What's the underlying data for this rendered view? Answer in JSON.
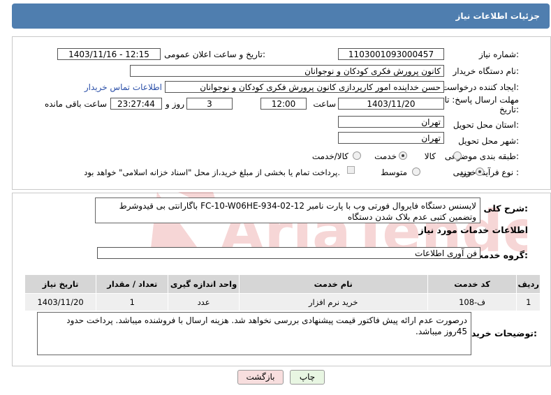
{
  "header": {
    "title": "جزئیات اطلاعات نیاز"
  },
  "form": {
    "need_number_label": "شماره نیاز:",
    "need_number": "1103001093000457",
    "announce_label": "تاریخ و ساعت اعلان عمومی:",
    "announce_value": "1403/11/16 - 12:15",
    "buyer_label": "نام دستگاه خریدار:",
    "buyer_value": "کانون پرورش فکری کودکان و نوجوانان",
    "creator_label": "ایجاد کننده درخواست:",
    "creator_value": "حسن خداینده امور کارپردازی  کانون پرورش فکری کودکان و نوجوانان",
    "contact_link": "اطلاعات تماس خریدار",
    "deadline_label_1": "مهلت ارسال پاسخ: تا",
    "deadline_label_2": "تاریخ:",
    "deadline_date": "1403/11/20",
    "time_label": "ساعت",
    "deadline_time": "12:00",
    "days_value": "3",
    "days_label": "روز و",
    "remaining_time": "23:27:44",
    "remaining_label": "ساعت باقی مانده",
    "province_label": "استان محل تحویل:",
    "province_value": "تهران",
    "city_label": "شهر محل تحویل:",
    "city_value": "تهران",
    "category_label": "طبقه بندی موضوعی:",
    "category_options": [
      "کالا",
      "خدمت",
      "کالا/خدمت"
    ],
    "category_selected": "خدمت",
    "process_label": "نوع فرآیند خرید :",
    "process_options": [
      "جزیی",
      "متوسط"
    ],
    "process_selected": "جزیی",
    "payment_note": "پرداخت تمام یا بخشی از مبلغ خرید،از محل \"اسناد خزانه اسلامی\" خواهد بود."
  },
  "description": {
    "label": "شرح کلی نیاز:",
    "text": "لایسنس دستگاه فایروال فورتی وب با پارت نامبر FC-10-W06HE-934-02-12 باگارانتی بی قیدوشرط وتضمین کتبی عدم بلاک شدن دستگاه"
  },
  "services": {
    "section_title": "اطلاعات خدمات مورد نیاز",
    "group_label": "گروه خدمت:",
    "group_value": "فن آوری اطلاعات",
    "table": {
      "headers": [
        "ردیف",
        "کد خدمت",
        "نام خدمت",
        "واحد اندازه گیری",
        "تعداد / مقدار",
        "تاریخ نیاز"
      ],
      "rows": [
        [
          "1",
          "ف-108",
          "خرید نرم افزار",
          "عدد",
          "1",
          "1403/11/20"
        ]
      ]
    }
  },
  "buyer_notes": {
    "label": "توضیحات خریدار:",
    "text": "درصورت عدم ارائه پیش فاکتور قیمت پیشنهادی بررسی نخواهد شد. هزینه ارسال با فروشنده میباشد. پرداخت حدود 45روز میباشد."
  },
  "buttons": {
    "print": "چاپ",
    "back": "بازگشت"
  },
  "watermark": {
    "text": "AriaTender.neT"
  },
  "colors": {
    "header_bg": "#4f7eaf",
    "print_bg": "#e8f6e2",
    "back_bg": "#f8dede",
    "watermark": "#d12020"
  }
}
